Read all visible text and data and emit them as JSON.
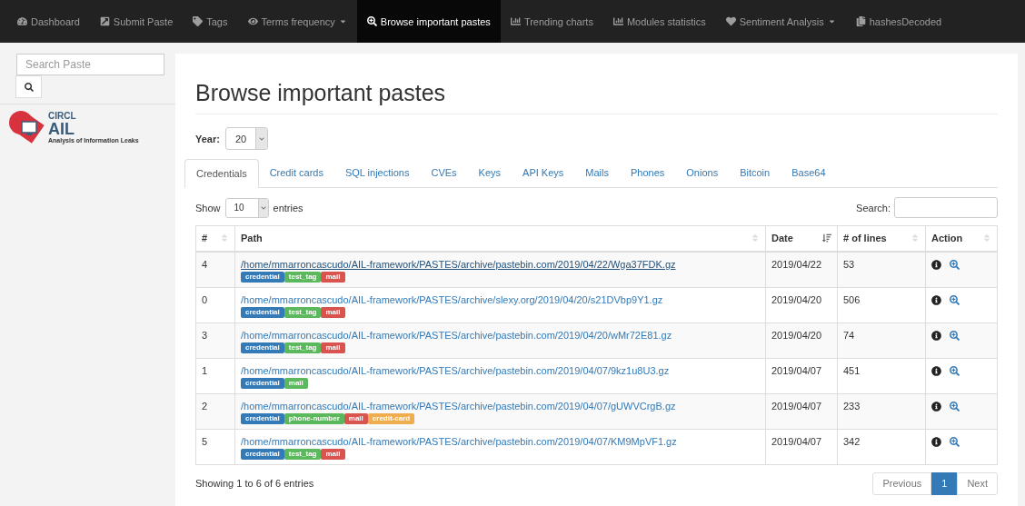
{
  "navbar": [
    {
      "label": "Dashboard",
      "selected": false,
      "dropdown": false
    },
    {
      "label": "Submit Paste",
      "selected": false,
      "dropdown": false
    },
    {
      "label": "Tags",
      "selected": false,
      "dropdown": false
    },
    {
      "label": "Terms frequency",
      "selected": false,
      "dropdown": true
    },
    {
      "label": "Browse important pastes",
      "selected": true,
      "dropdown": false
    },
    {
      "label": "Trending charts",
      "selected": false,
      "dropdown": false
    },
    {
      "label": "Modules statistics",
      "selected": false,
      "dropdown": false
    },
    {
      "label": "Sentiment Analysis",
      "selected": false,
      "dropdown": true
    },
    {
      "label": "hashesDecoded",
      "selected": false,
      "dropdown": false
    }
  ],
  "sidebar": {
    "search": {
      "placeholder": "Search Paste"
    },
    "logo": {
      "line1": "CIRCL",
      "line2": "AIL",
      "line3": "Analysis of Information Leaks"
    }
  },
  "page": {
    "title": "Browse important pastes",
    "year_label": "Year:",
    "year_value": "20"
  },
  "tabs": [
    {
      "label": "Credentials",
      "selected": true
    },
    {
      "label": "Credit cards",
      "selected": false
    },
    {
      "label": "SQL injections",
      "selected": false
    },
    {
      "label": "CVEs",
      "selected": false
    },
    {
      "label": "Keys",
      "selected": false
    },
    {
      "label": "API Keys",
      "selected": false
    },
    {
      "label": "Mails",
      "selected": false
    },
    {
      "label": "Phones",
      "selected": false
    },
    {
      "label": "Onions",
      "selected": false
    },
    {
      "label": "Bitcoin",
      "selected": false
    },
    {
      "label": "Base64",
      "selected": false
    }
  ],
  "table_controls": {
    "show_label": "Show",
    "entries_value": "10",
    "entries_label": "entries",
    "search_label": "Search:"
  },
  "table": {
    "columns": [
      {
        "label": "#",
        "sorted": false
      },
      {
        "label": "Path",
        "sorted": false
      },
      {
        "label": "Date",
        "sorted": true
      },
      {
        "label": "# of lines",
        "sorted": false
      },
      {
        "label": "Action",
        "sorted": false
      }
    ],
    "rows": [
      {
        "index": "4",
        "path": "/home/mmarroncascudo/AIL-framework/PASTES/archive/pastebin.com/2019/04/22/Wga37FDK.gz",
        "hovered": true,
        "tags": [
          {
            "label": "credential",
            "color": "#337ab7"
          },
          {
            "label": "test_tag",
            "color": "#5cb85c"
          },
          {
            "label": "mail",
            "color": "#d9534f"
          }
        ],
        "date": "2019/04/22",
        "lines": "53"
      },
      {
        "index": "0",
        "path": "/home/mmarroncascudo/AIL-framework/PASTES/archive/slexy.org/2019/04/20/s21DVbp9Y1.gz",
        "hovered": false,
        "tags": [
          {
            "label": "credential",
            "color": "#337ab7"
          },
          {
            "label": "test_tag",
            "color": "#5cb85c"
          },
          {
            "label": "mail",
            "color": "#d9534f"
          }
        ],
        "date": "2019/04/20",
        "lines": "506"
      },
      {
        "index": "3",
        "path": "/home/mmarroncascudo/AIL-framework/PASTES/archive/pastebin.com/2019/04/20/wMr72E81.gz",
        "hovered": false,
        "tags": [
          {
            "label": "credential",
            "color": "#337ab7"
          },
          {
            "label": "test_tag",
            "color": "#5cb85c"
          },
          {
            "label": "mail",
            "color": "#d9534f"
          }
        ],
        "date": "2019/04/20",
        "lines": "74"
      },
      {
        "index": "1",
        "path": "/home/mmarroncascudo/AIL-framework/PASTES/archive/pastebin.com/2019/04/07/9kz1u8U3.gz",
        "hovered": false,
        "tags": [
          {
            "label": "credential",
            "color": "#337ab7"
          },
          {
            "label": "mail",
            "color": "#5cb85c"
          }
        ],
        "date": "2019/04/07",
        "lines": "451"
      },
      {
        "index": "2",
        "path": "/home/mmarroncascudo/AIL-framework/PASTES/archive/pastebin.com/2019/04/07/gUWVCrgB.gz",
        "hovered": false,
        "tags": [
          {
            "label": "credential",
            "color": "#337ab7"
          },
          {
            "label": "phone-number",
            "color": "#5cb85c"
          },
          {
            "label": "mail",
            "color": "#d9534f"
          },
          {
            "label": "credit-card",
            "color": "#f0ad4e"
          }
        ],
        "date": "2019/04/07",
        "lines": "233"
      },
      {
        "index": "5",
        "path": "/home/mmarroncascudo/AIL-framework/PASTES/archive/pastebin.com/2019/04/07/KM9MpVF1.gz",
        "hovered": false,
        "tags": [
          {
            "label": "credential",
            "color": "#337ab7"
          },
          {
            "label": "test_tag",
            "color": "#5cb85c"
          },
          {
            "label": "mail",
            "color": "#d9534f"
          }
        ],
        "date": "2019/04/07",
        "lines": "342"
      }
    ]
  },
  "footer": {
    "info": "Showing 1 to 6 of 6 entries",
    "pagination": [
      {
        "label": "Previous",
        "selected": false
      },
      {
        "label": "1",
        "selected": true
      },
      {
        "label": "Next",
        "selected": false
      }
    ]
  }
}
